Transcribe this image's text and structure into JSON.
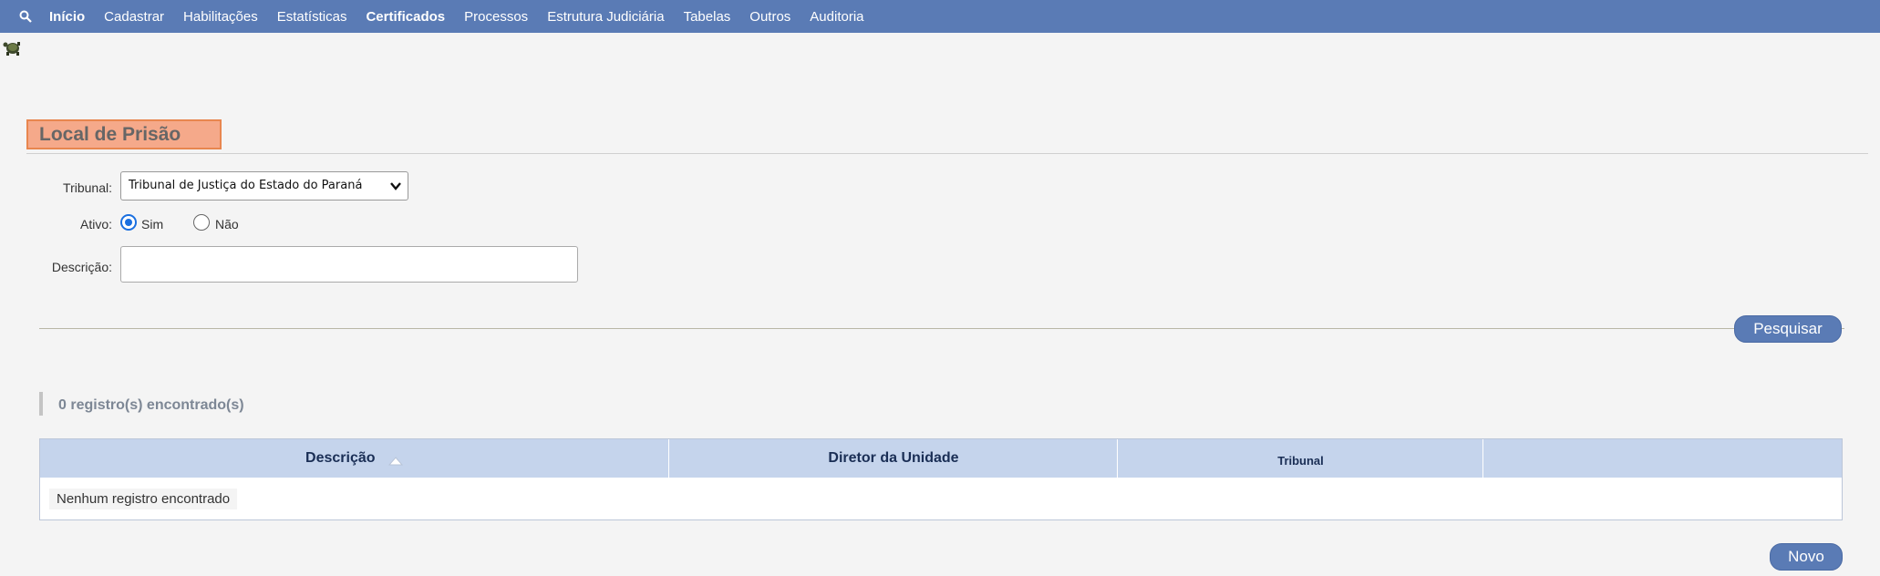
{
  "nav": {
    "search_icon": "search-icon",
    "items": [
      "Início",
      "Cadastrar",
      "Habilitações",
      "Estatísticas",
      "Certificados",
      "Processos",
      "Estrutura Judiciária",
      "Tabelas",
      "Outros",
      "Auditoria"
    ]
  },
  "page": {
    "title": "Local de Prisão"
  },
  "form": {
    "tribunal_label": "Tribunal:",
    "tribunal_value": "Tribunal de Justiça do Estado do Paraná",
    "ativo_label": "Ativo:",
    "ativo_options": [
      "Sim",
      "Não"
    ],
    "ativo_selected": "Sim",
    "descricao_label": "Descrição:",
    "descricao_value": ""
  },
  "actions": {
    "search_label": "Pesquisar",
    "new_label": "Novo"
  },
  "results": {
    "count_text": "0 registro(s) encontrado(s)",
    "columns": [
      "Descrição",
      "Diretor da Unidade",
      "Tribunal"
    ],
    "empty_text": "Nenhum registro encontrado"
  },
  "colors": {
    "nav_bg": "#5a7bb5",
    "title_bg": "#f5a98a",
    "header_bg": "#c5d4ec",
    "radio_accent": "#1a6fe0"
  }
}
